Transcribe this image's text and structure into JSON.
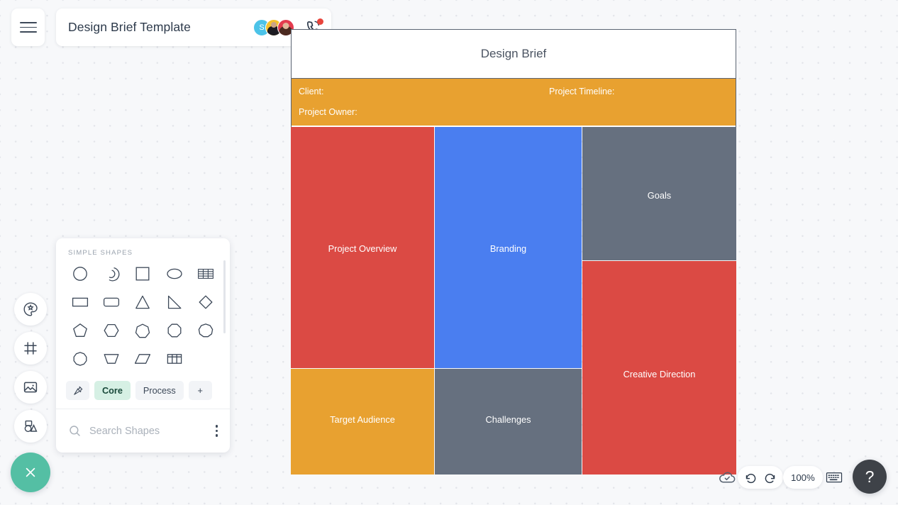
{
  "topbar": {
    "menu_icon": "hamburger-icon",
    "doc_title": "Design Brief Template",
    "avatars": [
      {
        "name": "avatar-s",
        "initial": "S",
        "color": "#4cc3e8"
      },
      {
        "name": "avatar-user-2",
        "initial": "",
        "color": "#f5c12e"
      },
      {
        "name": "avatar-user-3",
        "initial": "",
        "color": "#e33b4e"
      }
    ],
    "call_icon": "phone-call-icon",
    "call_badge": true
  },
  "document": {
    "header_title": "Design Brief",
    "meta": {
      "client_label": "Client:",
      "timeline_label": "Project Timeline:",
      "owner_label": "Project Owner:"
    },
    "blocks": [
      {
        "key": "overview",
        "label": "Project Overview",
        "color": "#db4a44"
      },
      {
        "key": "branding",
        "label": "Branding",
        "color": "#4a7ef0"
      },
      {
        "key": "goals",
        "label": "Goals",
        "color": "#66707f"
      },
      {
        "key": "creative",
        "label": "Creative Direction",
        "color": "#db4a44"
      },
      {
        "key": "audience",
        "label": "Target Audience",
        "color": "#e8a130"
      },
      {
        "key": "challenges",
        "label": "Challenges",
        "color": "#66707f"
      }
    ]
  },
  "rail": {
    "items": [
      {
        "name": "theme-palette-icon"
      },
      {
        "name": "frame-icon"
      },
      {
        "name": "image-icon"
      },
      {
        "name": "shapes-icon"
      }
    ],
    "fab": {
      "name": "close-fab",
      "icon": "close-icon",
      "color": "#54bfa4"
    }
  },
  "shapes_panel": {
    "section_title": "SIMPLE SHAPES",
    "shapes": [
      {
        "name": "circle-shape"
      },
      {
        "name": "arc-shape"
      },
      {
        "name": "square-shape"
      },
      {
        "name": "ellipse-shape"
      },
      {
        "name": "table-striped-shape"
      },
      {
        "name": "rectangle-shape"
      },
      {
        "name": "rounded-rectangle-shape"
      },
      {
        "name": "triangle-shape"
      },
      {
        "name": "right-triangle-shape"
      },
      {
        "name": "diamond-shape"
      },
      {
        "name": "pentagon-shape"
      },
      {
        "name": "hexagon-shape"
      },
      {
        "name": "heptagon-shape"
      },
      {
        "name": "octagon-shape"
      },
      {
        "name": "nonagon-shape"
      },
      {
        "name": "decagon-shape"
      },
      {
        "name": "trapezoid-shape"
      },
      {
        "name": "parallelogram-shape"
      },
      {
        "name": "grid-table-shape"
      }
    ],
    "tabs": [
      {
        "name": "pin-tab",
        "label": "",
        "icon": "pin-icon",
        "active": false
      },
      {
        "name": "core-tab",
        "label": "Core",
        "active": true
      },
      {
        "name": "process-tab",
        "label": "Process",
        "active": false
      },
      {
        "name": "add-tab",
        "label": "+",
        "active": false
      }
    ],
    "search": {
      "placeholder": "Search Shapes",
      "value": "",
      "icon": "search-icon",
      "more_icon": "kebab-menu-icon"
    }
  },
  "statusbar": {
    "cloud_icon": "cloud-saved-icon",
    "undo_icon": "undo-icon",
    "redo_icon": "redo-icon",
    "zoom_level": "100%",
    "keyboard_icon": "keyboard-icon",
    "help_label": "?"
  }
}
